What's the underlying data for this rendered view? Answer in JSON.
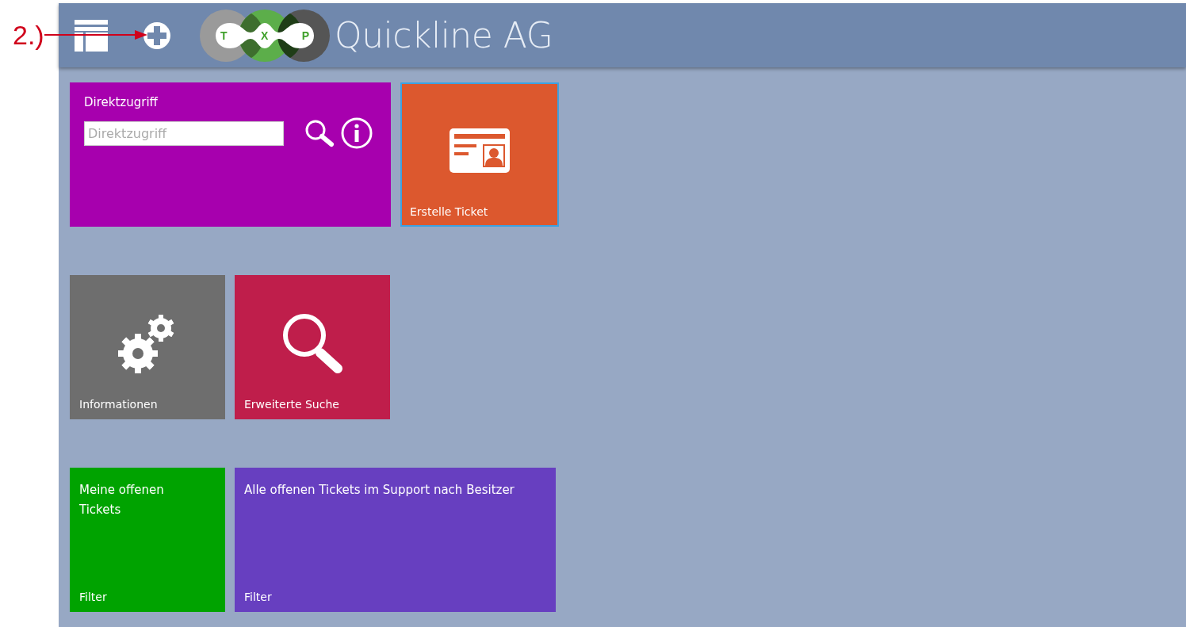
{
  "annotation": {
    "label": "2.)"
  },
  "header": {
    "logo_letters": [
      "T",
      "X",
      "P"
    ],
    "title": "Quickline AG"
  },
  "tile_rows": [
    [
      {
        "kind": "quick_access",
        "color": "#a700ae",
        "selected": false,
        "title": "Direktzugriff",
        "placeholder": "Direktzugriff"
      },
      {
        "kind": "ticket",
        "color": "#dc582e",
        "selected": true,
        "label": "Erstelle Ticket"
      }
    ],
    [
      {
        "kind": "settings",
        "color": "#6e6e6e",
        "selected": false,
        "label": "Informationen"
      },
      {
        "kind": "search",
        "color": "#bf1e4b",
        "selected": false,
        "label": "Erweiterte Suche"
      }
    ],
    [
      {
        "kind": "filter",
        "color": "#00a300",
        "selected": false,
        "title": "Meine offenen Tickets",
        "label": "Filter"
      },
      {
        "kind": "filter_wide",
        "color": "#673fc0",
        "selected": false,
        "title": "Alle offenen Tickets im Support nach Besitzer",
        "label": "Filter"
      }
    ]
  ]
}
